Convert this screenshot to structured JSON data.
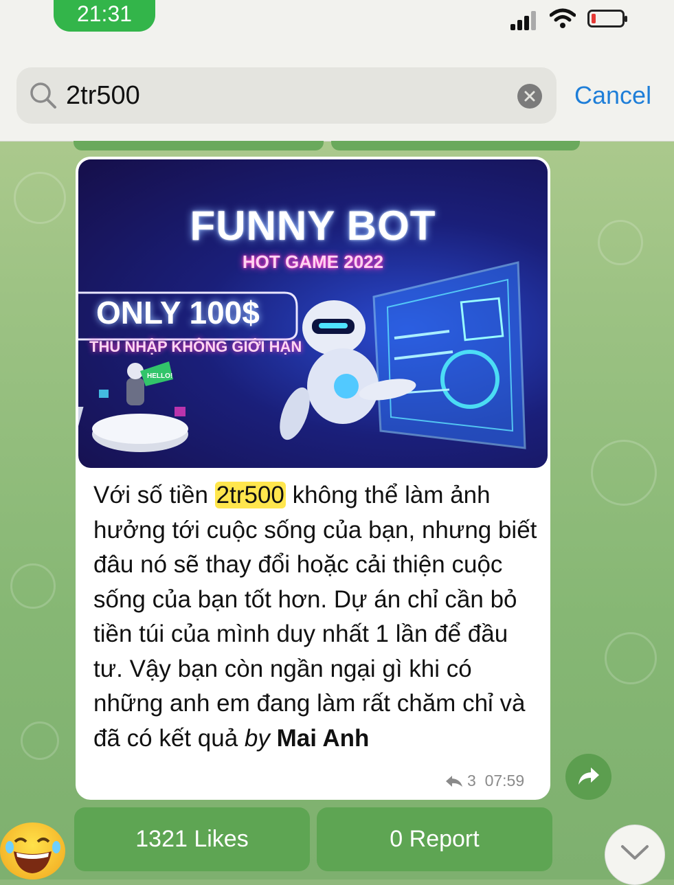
{
  "status_bar": {
    "time": "21:31"
  },
  "search": {
    "query": "2tr500",
    "cancel_label": "Cancel"
  },
  "message": {
    "image": {
      "title": "FUNNY BOT",
      "subtitle": "HOT GAME 2022",
      "price": "ONLY 100$",
      "tagline": "THU NHẬP KHÔNG GIỚI HẠN",
      "sign": "HELLO!"
    },
    "text_before": "Với số tiền ",
    "highlight": "2tr500",
    "text_after": " không thể làm ảnh hưởng tới cuộc sống của bạn, nhưng biết đâu nó sẽ thay đổi hoặc cải thiện cuộc sống của bạn tốt hơn. Dự án chỉ cần bỏ tiền túi của mình duy nhất 1 lần để đầu tư. Vậy bạn còn ngần ngại gì khi có những anh em đang làm rất chăm chỉ và đã có kết quả ",
    "byline_word": "by",
    "sender": "Mai Anh",
    "replies": "3",
    "time": "07:59"
  },
  "buttons": {
    "likes": "1321 Likes",
    "report": "0 Report"
  },
  "colors": {
    "highlight": "#ffe64d",
    "link": "#1e7ed8",
    "button": "#5ea553",
    "time_pill": "#33b54a"
  }
}
